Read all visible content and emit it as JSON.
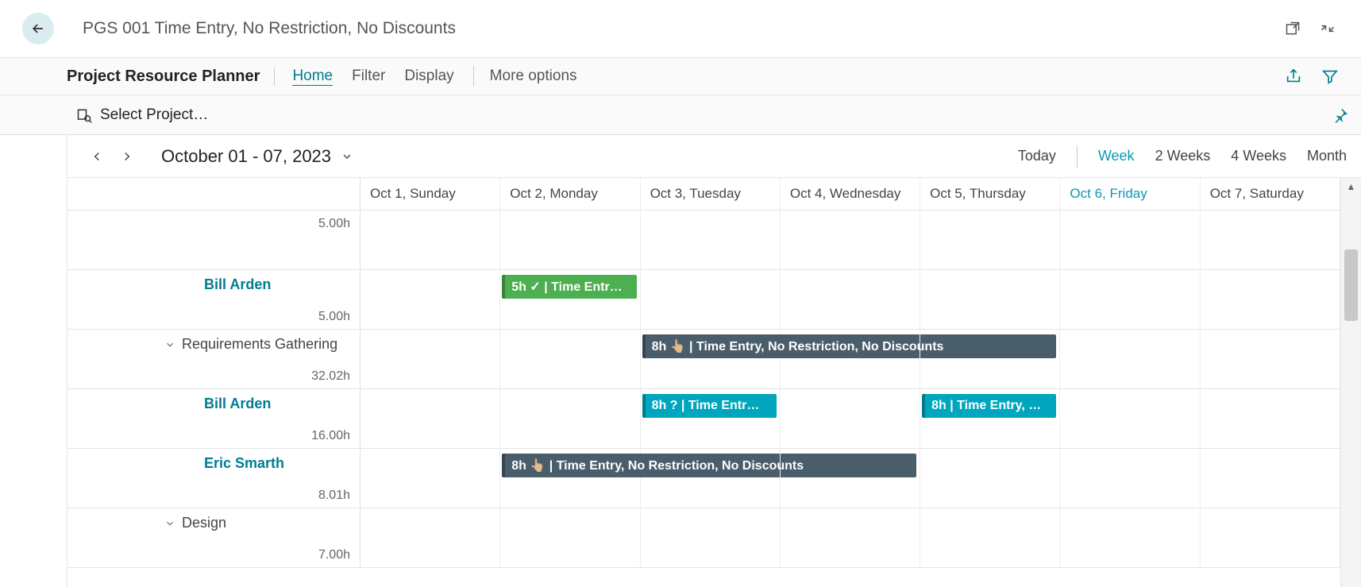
{
  "title": "PGS 001 Time Entry, No Restriction, No Discounts",
  "menu": {
    "label": "Project Resource Planner",
    "items": [
      "Home",
      "Filter",
      "Display"
    ],
    "more": "More options"
  },
  "select_project": "Select Project…",
  "range": {
    "label": "October 01 - 07, 2023",
    "today": "Today",
    "views": [
      "Week",
      "2 Weeks",
      "4 Weeks",
      "Month"
    ]
  },
  "headers": [
    "Oct 1, Sunday",
    "Oct 2, Monday",
    "Oct 3, Tuesday",
    "Oct 4, Wednesday",
    "Oct 5, Thursday",
    "Oct 6, Friday",
    "Oct 7, Saturday"
  ],
  "rows": [
    {
      "type": "hours-only",
      "hours": "5.00h"
    },
    {
      "type": "resource",
      "name": "Bill Arden",
      "hours": "5.00h",
      "events": [
        {
          "col": 2,
          "span": 1,
          "color": "green",
          "text": "5h ✓ | Time Entr…",
          "icon": "check"
        }
      ]
    },
    {
      "type": "task",
      "name": "Requirements Gathering",
      "hours": "32.02h",
      "events": [
        {
          "col": 3,
          "span": 3,
          "color": "grey",
          "text": "8h 👆🏼 | Time Entry, No Restriction, No Discounts",
          "icon": "hand"
        }
      ]
    },
    {
      "type": "resource",
      "name": "Bill Arden",
      "hours": "16.00h",
      "events": [
        {
          "col": 3,
          "span": 1,
          "color": "teal",
          "text": "8h ? | Time Entr…",
          "icon": "question"
        },
        {
          "col": 5,
          "span": 1,
          "color": "teal",
          "text": "8h | Time Entry, …",
          "icon": ""
        }
      ]
    },
    {
      "type": "resource",
      "name": "Eric Smarth",
      "hours": "8.01h",
      "events": [
        {
          "col": 2,
          "span": 3,
          "color": "grey",
          "text": "8h 👆🏼 | Time Entry, No Restriction, No Discounts",
          "icon": "hand"
        }
      ]
    },
    {
      "type": "task",
      "name": "Design",
      "hours": "7.00h",
      "events": []
    }
  ]
}
